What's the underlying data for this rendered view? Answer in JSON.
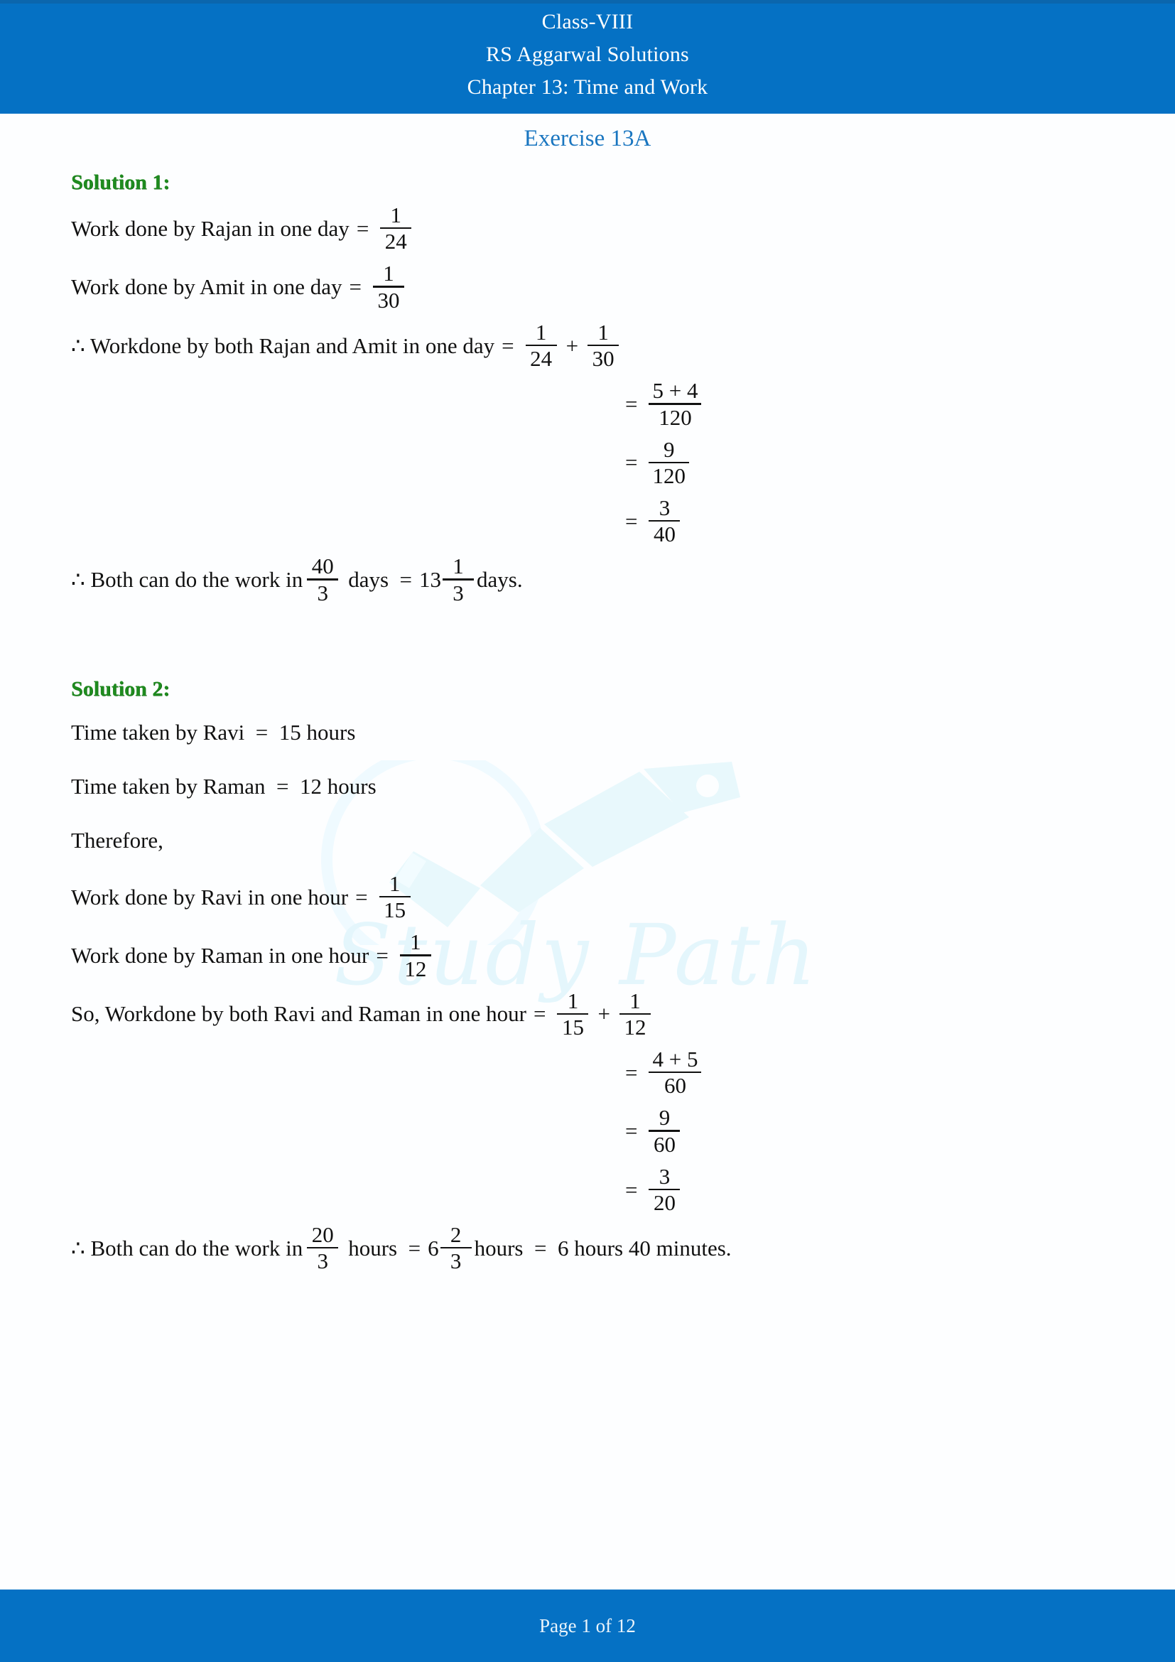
{
  "header": {
    "line1": "Class-VIII",
    "line2": "RS Aggarwal Solutions",
    "line3": "Chapter 13: Time and Work"
  },
  "exercise_title": "Exercise 13A",
  "watermark": {
    "text": "Study Path",
    "icon": "pen-nib-icon",
    "color": "#e4f6fc"
  },
  "colors": {
    "band_blue": "#0571c4",
    "band_blue_dark": "#0b66ad",
    "heading_green": "#1f8b1f",
    "exercise_blue": "#1a76c0",
    "body_black": "#111111"
  },
  "solutions": [
    {
      "heading": "Solution 1:",
      "lines": [
        {
          "id": "s1-l1",
          "pre": "Work done by Rajan in one day",
          "eq": "=",
          "frac": {
            "num": "1",
            "den": "24"
          }
        },
        {
          "id": "s1-l2",
          "pre": "Work done by Amit in one day",
          "eq": "=",
          "frac": {
            "num": "1",
            "den": "30"
          }
        },
        {
          "id": "s1-l3",
          "pre": "∴ Workdone by both Rajan and Amit in one day",
          "eq": "=",
          "frac": {
            "num": "1",
            "den": "24"
          },
          "op": "+",
          "frac2": {
            "num": "1",
            "den": "30"
          }
        },
        {
          "id": "s1-l4",
          "eq": "=",
          "frac": {
            "num": "5 + 4",
            "den": "120"
          }
        },
        {
          "id": "s1-l5",
          "eq": "=",
          "frac": {
            "num": "9",
            "den": "120"
          }
        },
        {
          "id": "s1-l6",
          "eq": "=",
          "frac": {
            "num": "3",
            "den": "40"
          }
        }
      ],
      "conclusion": {
        "pre": "∴ Both can do the work in",
        "frac": {
          "num": "40",
          "den": "3"
        },
        "mid": "days  =",
        "mixed": {
          "whole": "13",
          "num": "1",
          "den": "3"
        },
        "post": "days."
      }
    },
    {
      "heading": "Solution 2:",
      "lines": [
        {
          "id": "s2-l1",
          "pre": "Time taken by Ravi  =  15 hours"
        },
        {
          "id": "s2-l2",
          "pre": "Time taken by Raman  =  12 hours"
        },
        {
          "id": "s2-l3",
          "pre": "Therefore,"
        },
        {
          "id": "s2-l4",
          "pre": "Work done by Ravi in one hour",
          "eq": "=",
          "frac": {
            "num": "1",
            "den": "15"
          }
        },
        {
          "id": "s2-l5",
          "pre": "Work done by Raman in one hour",
          "eq": "=",
          "frac": {
            "num": "1",
            "den": "12"
          }
        },
        {
          "id": "s2-l6",
          "pre": "So, Workdone by both Ravi and Raman in one hour",
          "eq": "=",
          "frac": {
            "num": "1",
            "den": "15"
          },
          "op": "+",
          "frac2": {
            "num": "1",
            "den": "12"
          }
        },
        {
          "id": "s2-l7",
          "eq": "=",
          "frac": {
            "num": "4 + 5",
            "den": "60"
          }
        },
        {
          "id": "s2-l8",
          "eq": "=",
          "frac": {
            "num": "9",
            "den": "60"
          }
        },
        {
          "id": "s2-l9",
          "eq": "=",
          "frac": {
            "num": "3",
            "den": "20"
          }
        }
      ],
      "conclusion": {
        "pre": "∴ Both can do the work in",
        "frac": {
          "num": "20",
          "den": "3"
        },
        "mid": "hours  =",
        "mixed": {
          "whole": "6",
          "num": "2",
          "den": "3"
        },
        "post": "hours  =  6 hours 40 minutes."
      }
    }
  ],
  "footer": {
    "text": "Page 1 of 12"
  }
}
